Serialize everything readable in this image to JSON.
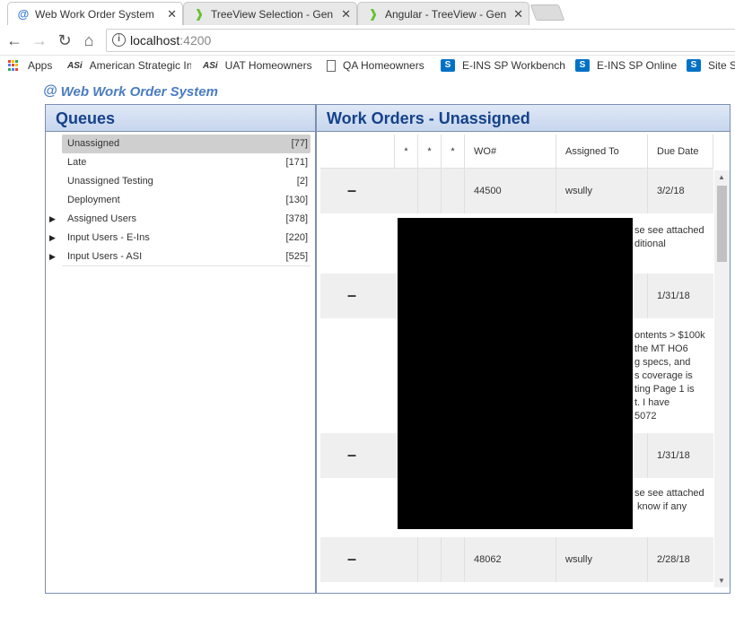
{
  "browser": {
    "tabs": [
      {
        "title": "Web Work Order System",
        "icon": "at-icon"
      },
      {
        "title": "TreeView Selection - Gen",
        "icon": "nativescript-icon"
      },
      {
        "title": "Angular - TreeView - Gen",
        "icon": "nativescript-icon"
      }
    ],
    "url_host": "localhost",
    "url_port": ":4200",
    "bookmarks": [
      "Apps",
      "American Strategic In",
      "UAT Homeowners",
      "QA Homeowners",
      "E-INS SP Workbench",
      "E-INS SP Online",
      "Site S"
    ]
  },
  "app": {
    "title": "Web Work Order System"
  },
  "queues": {
    "header": "Queues",
    "items": [
      {
        "label": "Unassigned",
        "count": "[77]"
      },
      {
        "label": "Late",
        "count": "[171]"
      },
      {
        "label": "Unassigned Testing",
        "count": "[2]"
      },
      {
        "label": "Deployment",
        "count": "[130]"
      },
      {
        "label": "Assigned Users",
        "count": "[378]"
      },
      {
        "label": "Input Users - E-Ins",
        "count": "[220]"
      },
      {
        "label": "Input Users - ASI",
        "count": "[525]"
      }
    ]
  },
  "workorders": {
    "header": "Work Orders - Unassigned",
    "columns": [
      "*",
      "*",
      "*",
      "WO#",
      "Assigned To",
      "Due Date"
    ],
    "rows": [
      {
        "expand": "–",
        "wo": "44500",
        "assigned": "wsully",
        "due": "3/2/18",
        "desc": "se see attached\nditional"
      },
      {
        "expand": "–",
        "wo": "",
        "assigned": "",
        "due": "1/31/18",
        "desc": "ontents > $100k\nthe MT HO6\ng specs, and\ns coverage is\nting Page 1 is\nt. I have\n5072"
      },
      {
        "expand": "–",
        "wo": "",
        "assigned": "",
        "due": "1/31/18",
        "desc": "se see attached\n know if any"
      },
      {
        "expand": "–",
        "wo": "48062",
        "assigned": "wsully",
        "due": "2/28/18",
        "desc": ""
      }
    ]
  }
}
